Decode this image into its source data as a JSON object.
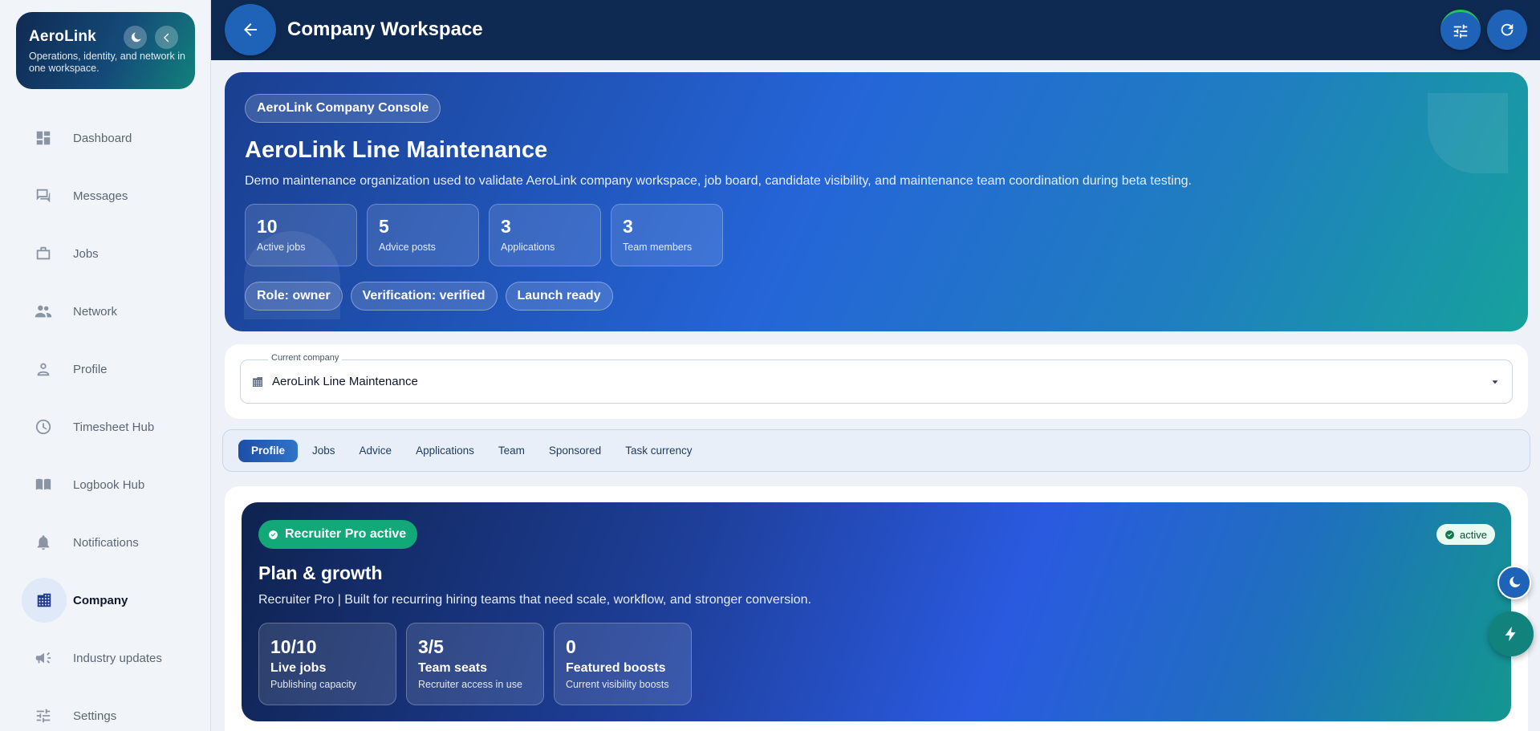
{
  "brand": {
    "name": "AeroLink",
    "tagline": "Operations, identity, and network in one workspace."
  },
  "nav": {
    "items": [
      {
        "label": "Dashboard",
        "icon": "dashboard-icon"
      },
      {
        "label": "Messages",
        "icon": "chat-icon"
      },
      {
        "label": "Jobs",
        "icon": "briefcase-icon"
      },
      {
        "label": "Network",
        "icon": "people-icon"
      },
      {
        "label": "Profile",
        "icon": "person-icon"
      },
      {
        "label": "Timesheet Hub",
        "icon": "clock-icon"
      },
      {
        "label": "Logbook Hub",
        "icon": "book-icon"
      },
      {
        "label": "Notifications",
        "icon": "bell-icon"
      },
      {
        "label": "Company",
        "icon": "building-icon",
        "active": true
      },
      {
        "label": "Industry updates",
        "icon": "megaphone-icon"
      },
      {
        "label": "Settings",
        "icon": "sliders-icon"
      }
    ]
  },
  "header": {
    "title": "Company Workspace"
  },
  "hero": {
    "chip": "AeroLink Company Console",
    "title": "AeroLink Line Maintenance",
    "description": "Demo maintenance organization used to validate AeroLink company workspace, job board, candidate visibility, and maintenance team coordination during beta testing.",
    "stats": [
      {
        "value": "10",
        "label": "Active jobs"
      },
      {
        "value": "5",
        "label": "Advice posts"
      },
      {
        "value": "3",
        "label": "Applications"
      },
      {
        "value": "3",
        "label": "Team members"
      }
    ],
    "chips": [
      "Role: owner",
      "Verification: verified",
      "Launch ready"
    ]
  },
  "company_select": {
    "label": "Current company",
    "value": "AeroLink Line Maintenance"
  },
  "tabs": [
    {
      "label": "Profile",
      "active": true
    },
    {
      "label": "Jobs"
    },
    {
      "label": "Advice"
    },
    {
      "label": "Applications"
    },
    {
      "label": "Team"
    },
    {
      "label": "Sponsored"
    },
    {
      "label": "Task currency"
    }
  ],
  "plan": {
    "chip": "Recruiter Pro active",
    "status": "active",
    "title": "Plan & growth",
    "description": "Recruiter Pro | Built for recurring hiring teams that need scale, workflow, and stronger conversion.",
    "stats": [
      {
        "value": "10/10",
        "title": "Live jobs",
        "subtitle": "Publishing capacity"
      },
      {
        "value": "3/5",
        "title": "Team seats",
        "subtitle": "Recruiter access in use"
      },
      {
        "value": "0",
        "title": "Featured boosts",
        "subtitle": "Current visibility boosts"
      }
    ]
  },
  "colors": {
    "header_bg": "#0f2a52",
    "accent": "#1e63b8",
    "success": "#12a878"
  }
}
